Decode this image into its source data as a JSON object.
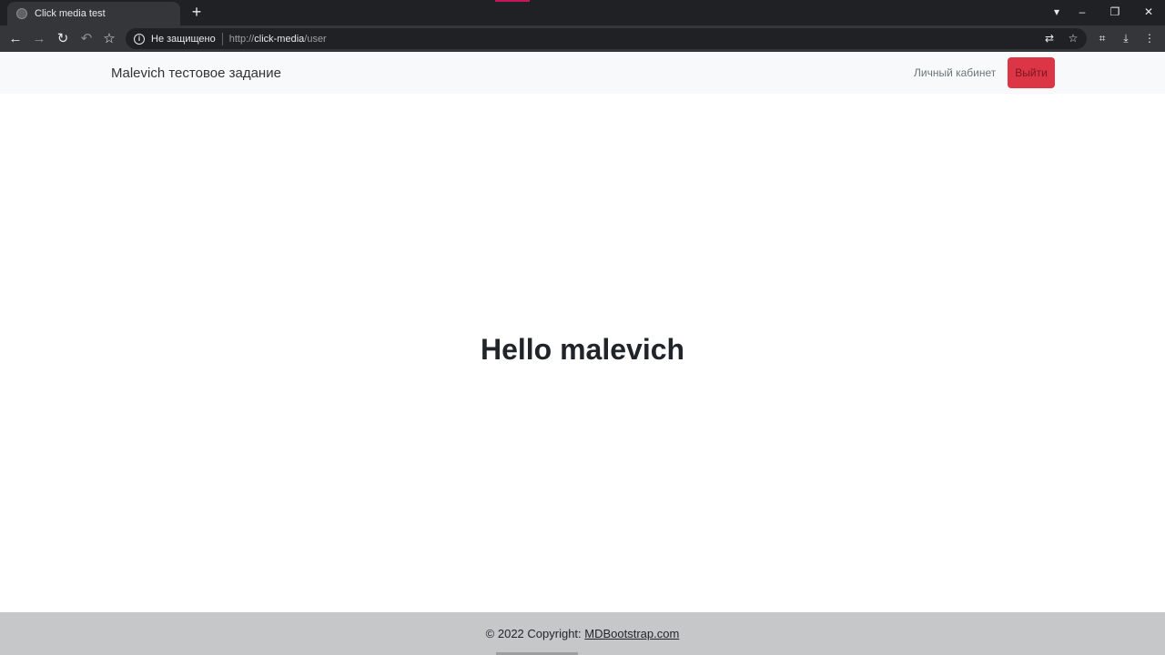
{
  "browser": {
    "tab_title": "Click media test",
    "new_tab": "+",
    "security_label": "Не защищено",
    "url_scheme": "http://",
    "url_host": "click-media",
    "url_path": "/user",
    "window_minimize": "–",
    "window_restore": "❐",
    "window_close": "✕"
  },
  "navbar": {
    "brand": "Malevich тестовое задание",
    "cabinet_link": "Личный кабинет",
    "logout_button": "Выйти"
  },
  "main": {
    "heading": "Hello malevich"
  },
  "footer": {
    "copyright_prefix": "© 2022 Copyright:",
    "copyright_link": "MDBootstrap.com"
  },
  "colors": {
    "danger": "#dc3545",
    "navbar_bg": "#f8f9fa",
    "footer_bg": "#c6c7c9"
  }
}
